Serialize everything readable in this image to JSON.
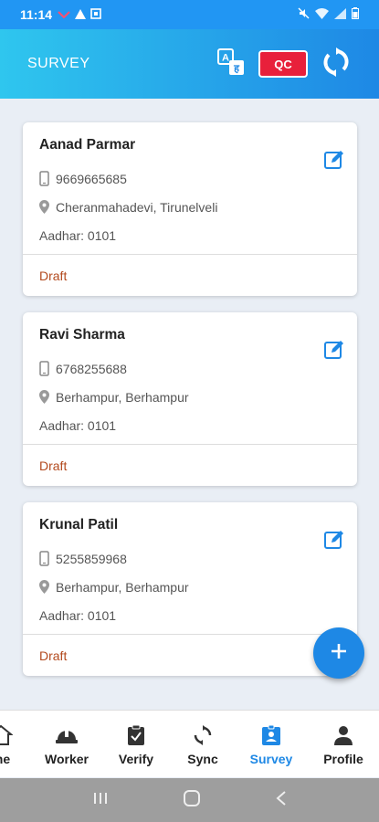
{
  "status_bar": {
    "time": "11:14"
  },
  "app_bar": {
    "title": "SURVEY",
    "qc_label": "QC"
  },
  "cards": [
    {
      "name": "Aanad Parmar",
      "phone": "9669665685",
      "location": "Cheranmahadevi, Tirunelveli",
      "aadhar": "Aadhar: 0101",
      "status": "Draft"
    },
    {
      "name": "Ravi Sharma",
      "phone": "6768255688",
      "location": "Berhampur, Berhampur",
      "aadhar": "Aadhar: 0101",
      "status": "Draft"
    },
    {
      "name": "Krunal Patil",
      "phone": "5255859968",
      "location": "Berhampur, Berhampur",
      "aadhar": "Aadhar: 0101",
      "status": "Draft"
    }
  ],
  "bottom_nav": {
    "items": [
      {
        "label": "me",
        "icon": "home-icon"
      },
      {
        "label": "Worker",
        "icon": "helmet-icon"
      },
      {
        "label": "Verify",
        "icon": "clipboard-icon"
      },
      {
        "label": "Sync",
        "icon": "sync-icon"
      },
      {
        "label": "Survey",
        "icon": "survey-badge-icon"
      },
      {
        "label": "Profile",
        "icon": "person-icon"
      }
    ],
    "active": "Survey"
  },
  "colors": {
    "primary": "#1e88e5",
    "accent_red": "#e8203b",
    "draft": "#b34a1e"
  }
}
